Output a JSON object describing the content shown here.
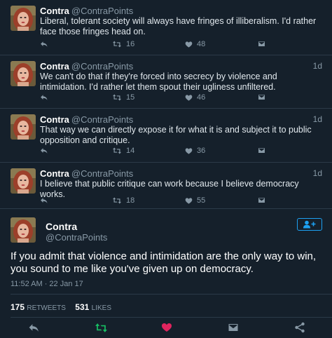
{
  "colors": {
    "background": "#15202b",
    "text": "#e1e8ed",
    "muted": "#8899a6",
    "accent_blue": "#1da1f2",
    "retweet_green": "#17bf63",
    "like_red": "#e0245e"
  },
  "replies": [
    {
      "name": "Contra",
      "handle": "@ContraPoints",
      "time": "",
      "text": "Liberal, tolerant society will always have fringes of illiberalism. I'd rather face those fringes head on.",
      "retweets": "16",
      "likes": "48"
    },
    {
      "name": "Contra",
      "handle": "@ContraPoints",
      "time": "1d",
      "text": "We can't do that if they're forced into secrecy by violence and intimidation. I'd rather let them spout their ugliness unfiltered.",
      "retweets": "15",
      "likes": "46"
    },
    {
      "name": "Contra",
      "handle": "@ContraPoints",
      "time": "1d",
      "text": "That way we can directly expose it for what it is and subject it to public opposition and critique.",
      "retweets": "14",
      "likes": "36"
    },
    {
      "name": "Contra",
      "handle": "@ContraPoints",
      "time": "1d",
      "text": "I believe that public critique can work because I believe democracy works.",
      "retweets": "18",
      "likes": "55"
    }
  ],
  "main_tweet": {
    "name": "Contra",
    "handle": "@ContraPoints",
    "text": "If you admit that violence and intimidation are the only way to win, you sound to me like you've given up on democracy.",
    "timestamp": "11:52 AM · 22 Jan 17",
    "retweets_count": "175",
    "retweets_label": "RETWEETS",
    "likes_count": "531",
    "likes_label": "LIKES"
  },
  "icons": {
    "reply": "reply-icon",
    "retweet": "retweet-icon",
    "like": "heart-icon",
    "dm": "envelope-icon",
    "share": "share-icon",
    "follow": "add-user-icon"
  }
}
